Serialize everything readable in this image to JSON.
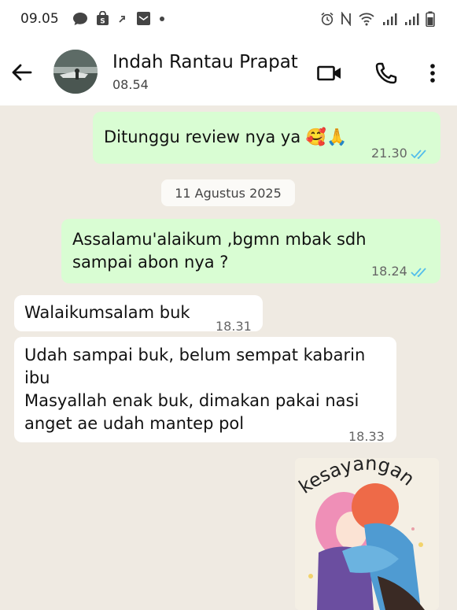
{
  "status_bar": {
    "time": "09.05",
    "left_icons": [
      "chat-icon",
      "shopee-icon",
      "arrow-icon",
      "gallery-icon",
      "dot-icon"
    ],
    "right_icons": [
      "alarm-icon",
      "nfc-icon",
      "wifi-icon",
      "signal-icon",
      "signal-icon",
      "battery-icon"
    ]
  },
  "header": {
    "contact_name": "Indah Rantau Prapat",
    "subtitle": "08.54",
    "icons": [
      "back-arrow-icon",
      "video-call-icon",
      "phone-icon",
      "more-vert-icon"
    ]
  },
  "messages": [
    {
      "direction": "outgoing",
      "text_lines": [
        "Ditunggu review nya ya 🥰🙏"
      ],
      "time": "21.30",
      "status": "read"
    },
    {
      "type": "date",
      "text": "11 Agustus 2025"
    },
    {
      "direction": "outgoing",
      "text_lines": [
        "Assalamu'alaikum ,bgmn mbak sdh",
        "sampai abon nya ?"
      ],
      "time": "18.24",
      "status": "read"
    },
    {
      "direction": "incoming",
      "text_lines": [
        "Walaikumsalam buk"
      ],
      "time": "18.31"
    },
    {
      "direction": "incoming",
      "text_lines": [
        "Udah sampai buk, belum sempat kabarin",
        "ibu",
        "Masyallah enak buk, dimakan pakai nasi",
        "anget ae udah mantep pol"
      ],
      "time": "18.33"
    },
    {
      "direction": "incoming",
      "type": "sticker",
      "sticker_text": "kesayangan"
    }
  ],
  "colors": {
    "chat_background": "#efeae2",
    "outgoing_bubble": "#d9fdd3",
    "incoming_bubble": "#ffffff",
    "read_ticks": "#53bdeb"
  }
}
